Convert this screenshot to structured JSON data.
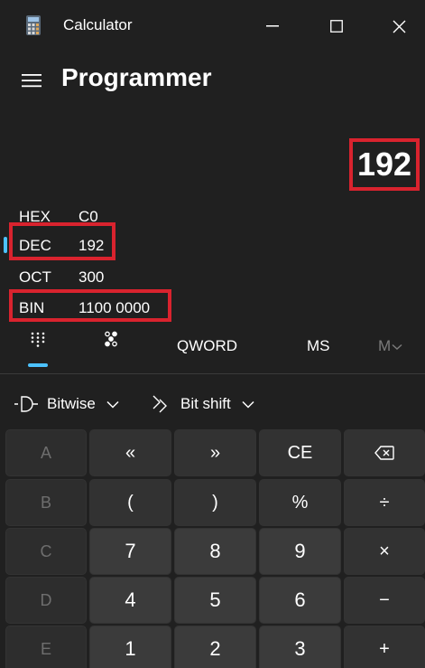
{
  "window": {
    "title": "Calculator",
    "icon": "calculator-icon",
    "controls": [
      "minimize-icon",
      "maximize-icon",
      "close-icon"
    ]
  },
  "header": {
    "menu_icon": "hamburger-menu-icon",
    "mode": "Programmer"
  },
  "display": {
    "value": "192"
  },
  "radix": {
    "hex": {
      "label": "HEX",
      "value": "C0"
    },
    "dec": {
      "label": "DEC",
      "value": "192"
    },
    "oct": {
      "label": "OCT",
      "value": "300"
    },
    "bin": {
      "label": "BIN",
      "value": "1100 0000"
    },
    "selected": "DEC"
  },
  "toolbar": {
    "full_keypad_icon": "keypad-dots-icon",
    "bit_toggle_icon": "bit-toggle-dots-icon",
    "word_size": "QWORD",
    "ms": "MS",
    "m_dropdown": "M"
  },
  "dropdowns": {
    "bitwise": "Bitwise",
    "bitshift": "Bit shift"
  },
  "keypad": {
    "rows": [
      [
        "A",
        "«",
        "»",
        "CE",
        "⌫"
      ],
      [
        "B",
        "(",
        ")",
        "%",
        "÷"
      ],
      [
        "C",
        "7",
        "8",
        "9",
        "×"
      ],
      [
        "D",
        "4",
        "5",
        "6",
        "−"
      ],
      [
        "E",
        "1",
        "2",
        "3",
        "+"
      ]
    ]
  },
  "colors": {
    "background": "#202020",
    "accent": "#4cc2ff",
    "highlight_box": "#d9232e"
  }
}
